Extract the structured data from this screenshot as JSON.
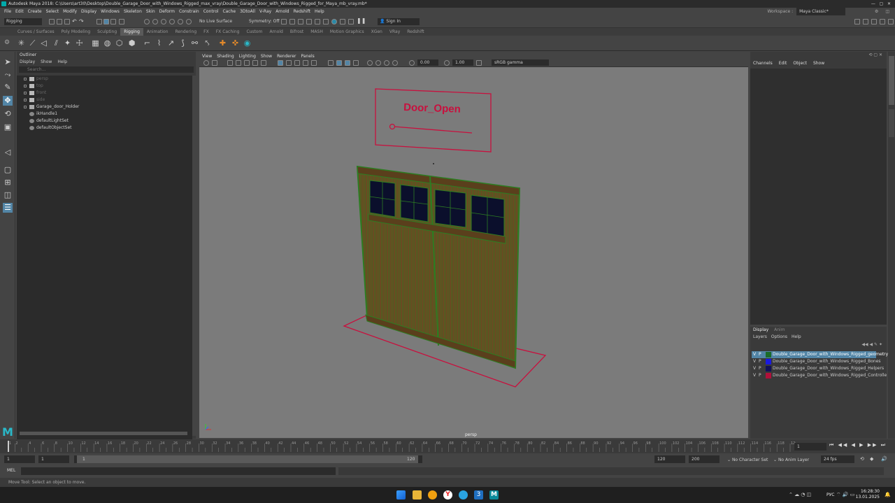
{
  "window": {
    "title": "Autodesk Maya 2018: C:\\Users\\art30\\Desktop\\Double_Garage_Door_with_Windows_Rigged_max_vray\\Double_Garage_Door_with_Windows_Rigged_for_Maya_mb_vray.mb*"
  },
  "menubar": [
    "File",
    "Edit",
    "Create",
    "Select",
    "Modify",
    "Display",
    "Windows",
    "Skeleton",
    "Skin",
    "Deform",
    "Constrain",
    "Control",
    "Cache",
    "3DtoAll",
    "V-Ray",
    "Arnold",
    "Redshift",
    "Help"
  ],
  "workspace": {
    "label": "Workspace :",
    "value": "Maya Classic*"
  },
  "status": {
    "mode": "Rigging",
    "live_surface": "No Live Surface",
    "symmetry": "Symmetry: Off",
    "sign_in": "Sign In"
  },
  "shelf_tabs": [
    "Curves / Surfaces",
    "Poly Modeling",
    "Sculpting",
    "Rigging",
    "Animation",
    "Rendering",
    "FX",
    "FX Caching",
    "Custom",
    "Arnold",
    "Bifrost",
    "MASH",
    "Motion Graphics",
    "XGen",
    "VRay",
    "Redshift"
  ],
  "shelf_active": "Rigging",
  "outliner": {
    "title": "Outliner",
    "menu": [
      "Display",
      "Show",
      "Help"
    ],
    "search_placeholder": "Search...",
    "items": [
      {
        "label": "persp",
        "dim": true,
        "expand": true
      },
      {
        "label": "top",
        "dim": true,
        "expand": true
      },
      {
        "label": "front",
        "dim": true,
        "expand": true
      },
      {
        "label": "side",
        "dim": true,
        "expand": true
      },
      {
        "label": "Garage_door_Holder",
        "dim": false,
        "expand": true
      },
      {
        "label": "ikHandle1",
        "dim": false,
        "expand": false
      },
      {
        "label": "defaultLightSet",
        "dim": false,
        "expand": false
      },
      {
        "label": "defaultObjectSet",
        "dim": false,
        "expand": false
      }
    ]
  },
  "viewport": {
    "menu": [
      "View",
      "Shading",
      "Lighting",
      "Show",
      "Renderer",
      "Panels"
    ],
    "exposure": "0.00",
    "gamma": "1.00",
    "colorspace": "sRGB gamma",
    "camera_label": "persp",
    "control_text": "Door_Open"
  },
  "channelbox": {
    "menu": [
      "Channels",
      "Edit",
      "Object",
      "Show"
    ]
  },
  "layers": {
    "tabs": [
      "Display",
      "Anim"
    ],
    "menu": [
      "Layers",
      "Options",
      "Help"
    ],
    "items": [
      {
        "v": "V",
        "p": "P",
        "color": "#1b6b2a",
        "name": "Double_Garage_Door_with_Windows_Rigged_geometry",
        "sel": true
      },
      {
        "v": "V",
        "p": "P",
        "color": "#1a1ae0",
        "name": "Double_Garage_Door_with_Windows_Rigged_Bones",
        "sel": false
      },
      {
        "v": "V",
        "p": "P",
        "color": "#12125a",
        "name": "Double_Garage_Door_with_Windows_Rigged_Helpers",
        "sel": false
      },
      {
        "v": "V",
        "p": "P",
        "color": "#b0103a",
        "name": "Double_Garage_Door_with_Windows_Rigged_Controlle",
        "sel": false
      }
    ]
  },
  "timeline": {
    "ticks": [
      "1",
      "2",
      "4",
      "6",
      "8",
      "10",
      "12",
      "14",
      "16",
      "18",
      "20",
      "22",
      "24",
      "26",
      "28",
      "30",
      "32",
      "34",
      "36",
      "38",
      "40",
      "42",
      "44",
      "46",
      "48",
      "50",
      "52",
      "54",
      "56",
      "58",
      "60",
      "62",
      "64",
      "66",
      "68",
      "70",
      "72",
      "74",
      "76",
      "78",
      "80",
      "82",
      "84",
      "86",
      "88",
      "90",
      "92",
      "94",
      "96",
      "98",
      "100",
      "102",
      "104",
      "106",
      "108",
      "110",
      "112",
      "114",
      "116",
      "118",
      "120"
    ],
    "current": "1"
  },
  "range": {
    "start": "1",
    "range_start": "1",
    "slider_start": "1",
    "slider_end": "120",
    "range_end": "120",
    "end": "200",
    "character": "No Character Set",
    "anim_layer": "No Anim Layer",
    "fps": "24 fps"
  },
  "mel": {
    "label": "MEL"
  },
  "helpline": "Move Tool: Select an object to move.",
  "tray": {
    "lang": "РУС",
    "time": "16:28:30",
    "date": "13.01.2025"
  }
}
